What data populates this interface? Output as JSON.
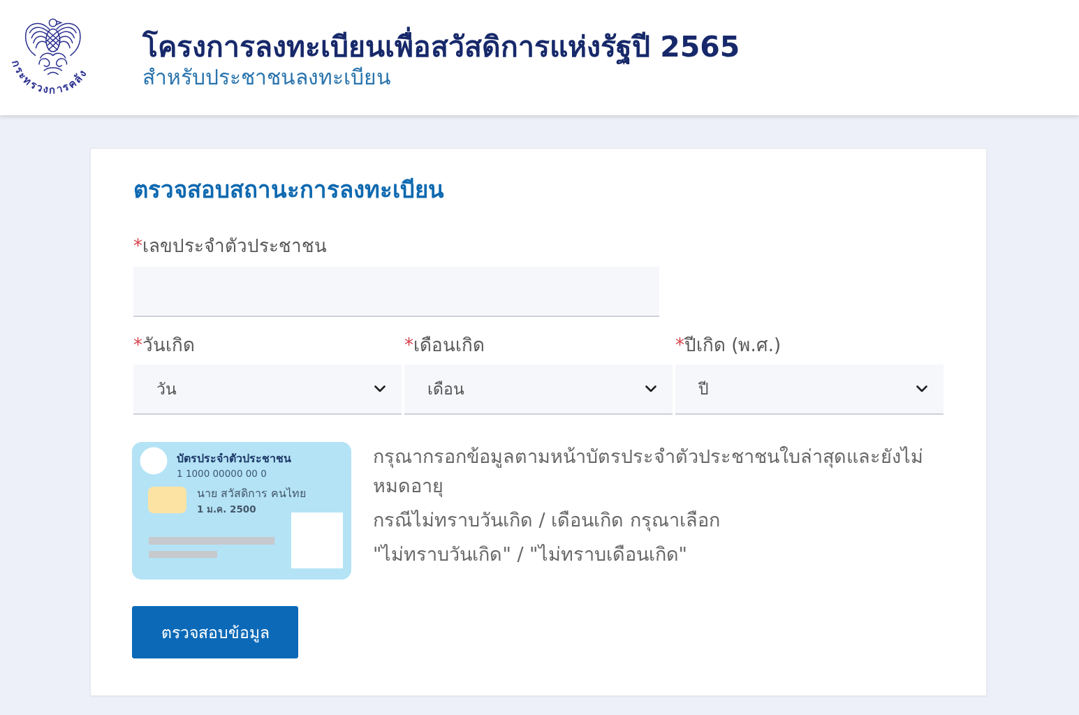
{
  "header": {
    "logo_text": "กระทรวงการคลัง",
    "title": "โครงการลงทะเบียนเพื่อสวัสดิการแห่งรัฐปี 2565",
    "subtitle": "สำหรับประชาชนลงทะเบียน"
  },
  "form": {
    "heading": "ตรวจสอบสถานะการลงทะเบียน",
    "id_field": {
      "required_mark": "*",
      "label": "เลขประจำตัวประชาชน"
    },
    "birth_fields": [
      {
        "required_mark": "*",
        "label": "วันเกิด",
        "value": "วัน"
      },
      {
        "required_mark": "*",
        "label": "เดือนเกิด",
        "value": "เดือน"
      },
      {
        "required_mark": "*",
        "label": "ปีเกิด (พ.ศ.)",
        "value": "ปี"
      }
    ],
    "id_card_sample": {
      "title": "บัตรประจำตัวประชาชน",
      "number": "1 1000 00000 00 0",
      "name": "นาย สวัสดิการ คนไทย",
      "birth_date": "1 ม.ค. 2500"
    },
    "instructions": [
      "กรุณากรอกข้อมูลตามหน้าบัตรประจำตัวประชาชนใบล่าสุดและยังไม่หมดอายุ",
      "กรณีไม่ทราบวันเกิด / เดือนเกิด กรุณาเลือก",
      "\"ไม่ทราบวันเกิด\" / \"ไม่ทราบเดือนเกิด\""
    ],
    "submit_button": "ตรวจสอบข้อมูล"
  }
}
